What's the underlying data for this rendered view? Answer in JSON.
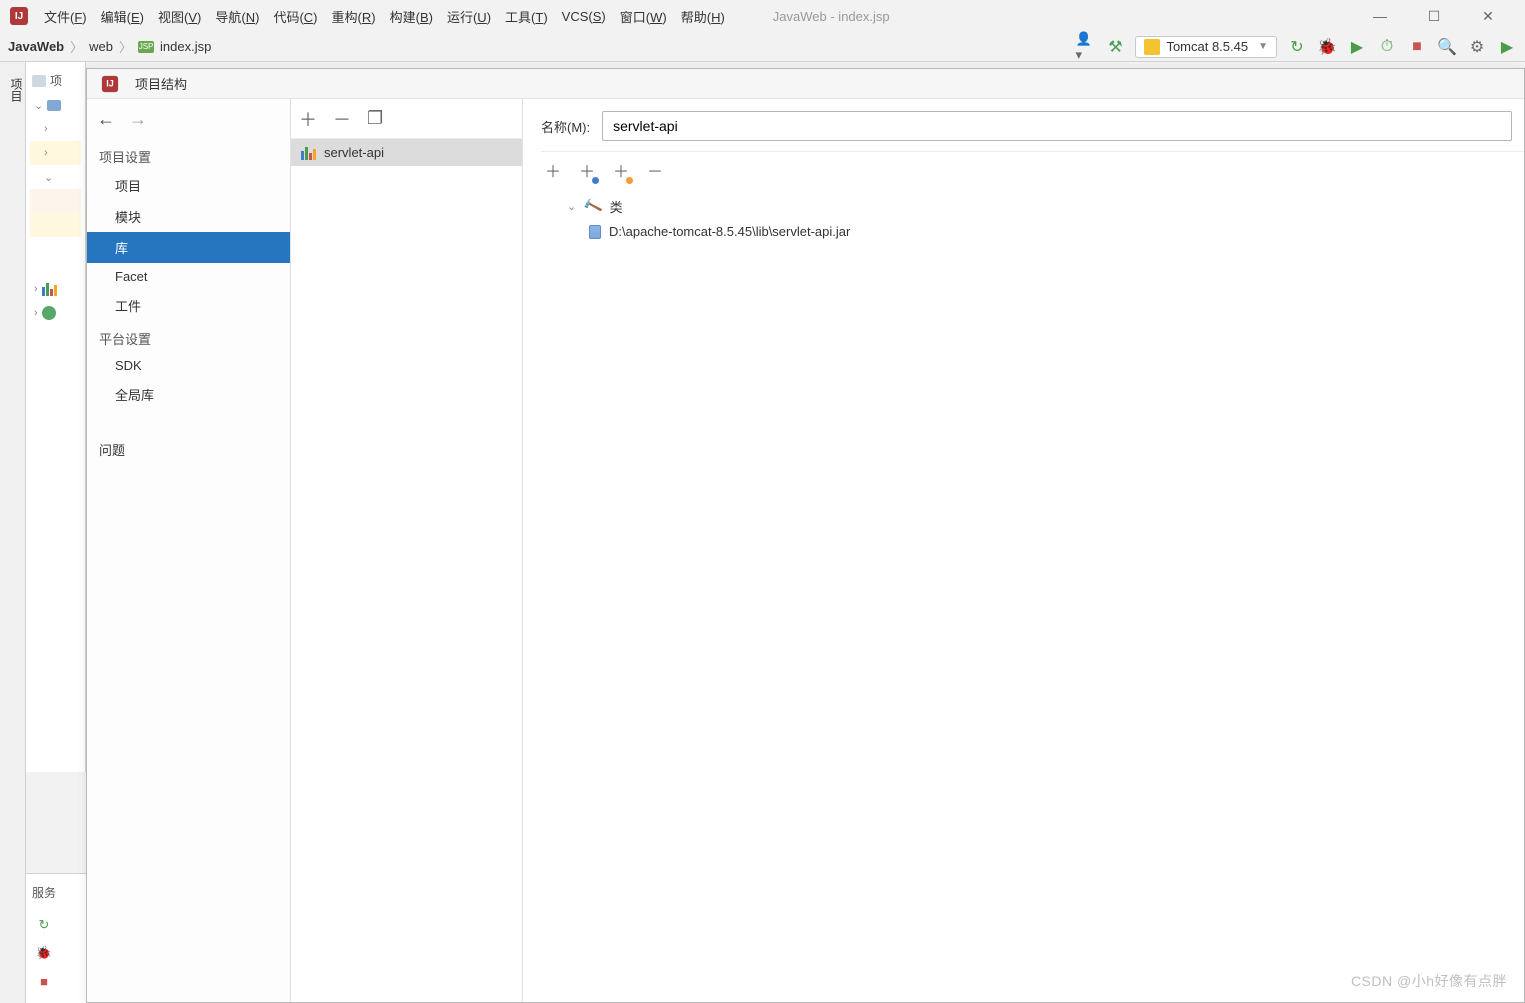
{
  "window": {
    "app_title": "JavaWeb - index.jsp"
  },
  "menubar": {
    "items": [
      {
        "label": "文件(F)",
        "u": "F"
      },
      {
        "label": "编辑(E)",
        "u": "E"
      },
      {
        "label": "视图(V)",
        "u": "V"
      },
      {
        "label": "导航(N)",
        "u": "N"
      },
      {
        "label": "代码(C)",
        "u": "C"
      },
      {
        "label": "重构(R)",
        "u": "R"
      },
      {
        "label": "构建(B)",
        "u": "B"
      },
      {
        "label": "运行(U)",
        "u": "U"
      },
      {
        "label": "工具(T)",
        "u": "T"
      },
      {
        "label": "VCS(S)",
        "u": "S"
      },
      {
        "label": "窗口(W)",
        "u": "W"
      },
      {
        "label": "帮助(H)",
        "u": "H"
      }
    ]
  },
  "breadcrumb": {
    "project": "JavaWeb",
    "folder": "web",
    "file": "index.jsp"
  },
  "runconfig": {
    "label": "Tomcat 8.5.45"
  },
  "left_rail": {
    "project_tab": "项目"
  },
  "project_panel": {
    "header": "项"
  },
  "services_dock": {
    "header": "服务"
  },
  "dialog": {
    "title": "项目结构",
    "left": {
      "section_project": "项目设置",
      "items_project": [
        "项目",
        "模块",
        "库",
        "Facet",
        "工件"
      ],
      "selected_project_index": 2,
      "section_platform": "平台设置",
      "items_platform": [
        "SDK",
        "全局库"
      ],
      "section_issues": "问题"
    },
    "mid": {
      "libraries": [
        {
          "name": "servlet-api"
        }
      ],
      "selected_index": 0
    },
    "right": {
      "name_label": "名称(M):",
      "name_value": "servlet-api",
      "tree_root": "类",
      "jar_path": "D:\\apache-tomcat-8.5.45\\lib\\servlet-api.jar"
    }
  },
  "watermark": "CSDN @小h好像有点胖"
}
